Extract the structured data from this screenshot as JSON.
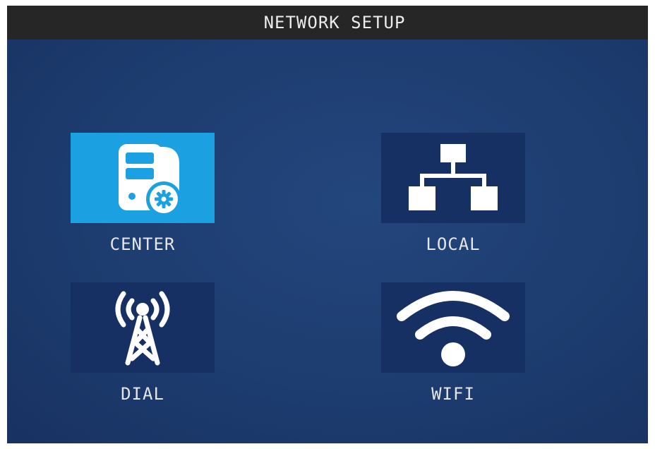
{
  "header": {
    "title": "NETWORK SETUP"
  },
  "menu": {
    "selected": "CENTER",
    "items": [
      {
        "label": "CENTER",
        "icon": "server-gear-icon"
      },
      {
        "label": "LOCAL",
        "icon": "network-tree-icon"
      },
      {
        "label": "DIAL",
        "icon": "antenna-tower-icon"
      },
      {
        "label": "WIFI",
        "icon": "wifi-icon"
      }
    ]
  },
  "colors": {
    "background": "#1d3c6f",
    "title_bar": "#262626",
    "tile": "#173063",
    "tile_selected": "#1ba0e2",
    "icon": "#ffffff"
  }
}
